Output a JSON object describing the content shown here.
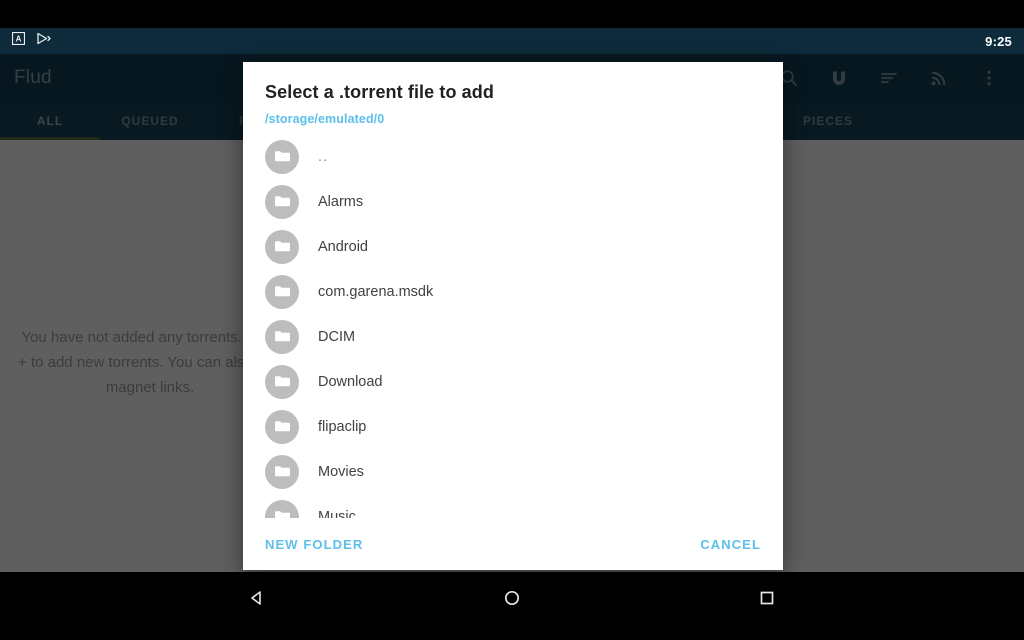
{
  "status_bar": {
    "clock": "9:25",
    "icons": [
      "subtitles-icon",
      "cast-play-icon"
    ]
  },
  "app_bar": {
    "title": "Flud",
    "actions": [
      {
        "name": "search-icon",
        "label": "Search"
      },
      {
        "name": "magnet-icon",
        "label": "Add magnet link"
      },
      {
        "name": "sort-icon",
        "label": "Sort"
      },
      {
        "name": "rss-icon",
        "label": "RSS feeds"
      },
      {
        "name": "overflow-menu-icon",
        "label": "More options"
      }
    ]
  },
  "tabs": [
    {
      "label": "ALL",
      "active": true
    },
    {
      "label": "QUEUED",
      "active": false
    },
    {
      "label": "FIN",
      "active": false
    },
    {
      "label": "PIECES",
      "active": false
    }
  ],
  "empty_state": {
    "text": "You have not added any torrents. Click + to add new torrents. You can also add magnet links."
  },
  "dialog": {
    "title": "Select a .torrent file to add",
    "path": "/storage/emulated/0",
    "files": [
      {
        "name": "..",
        "icon": "folder-icon"
      },
      {
        "name": "Alarms",
        "icon": "folder-icon"
      },
      {
        "name": "Android",
        "icon": "folder-icon"
      },
      {
        "name": "com.garena.msdk",
        "icon": "folder-icon"
      },
      {
        "name": "DCIM",
        "icon": "folder-icon"
      },
      {
        "name": "Download",
        "icon": "folder-icon"
      },
      {
        "name": "flipaclip",
        "icon": "folder-icon"
      },
      {
        "name": "Movies",
        "icon": "folder-icon"
      },
      {
        "name": "Music",
        "icon": "folder-icon"
      }
    ],
    "new_folder_label": "NEW FOLDER",
    "cancel_label": "CANCEL"
  },
  "nav_bar": {
    "back_label": "Back",
    "home_label": "Home",
    "recents_label": "Recents"
  },
  "colors": {
    "app_bar": "#133e54",
    "status_bar": "#0d2b3a",
    "tab_bar": "#174257",
    "tab_indicator": "#5b6b3c",
    "accent": "#5bc0ea",
    "folder_avatar": "#bdbdbd"
  }
}
